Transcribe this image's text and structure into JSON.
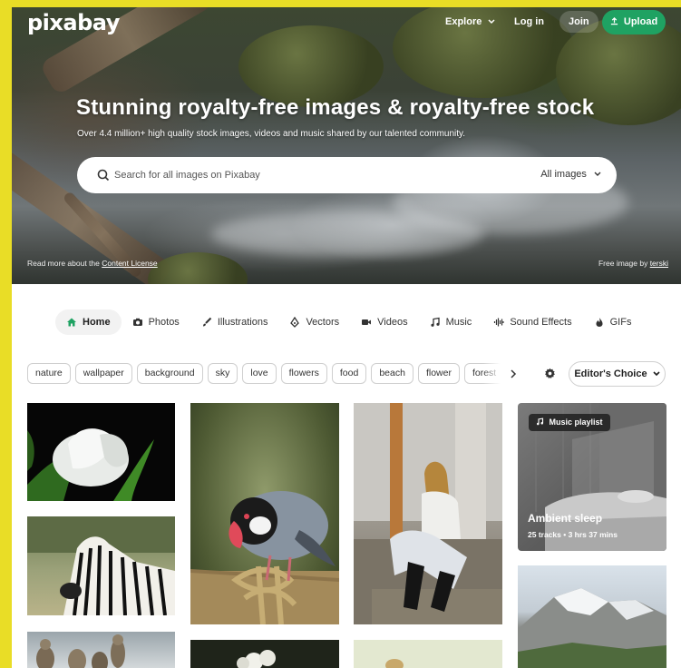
{
  "header": {
    "logo": "pixabay",
    "nav": {
      "explore": "Explore",
      "login": "Log in",
      "join": "Join",
      "upload": "Upload"
    }
  },
  "hero": {
    "title": "Stunning royalty-free images & royalty-free stock",
    "subtitle": "Over 4.4 million+ high quality stock images, videos and music shared by our talented community.",
    "search_placeholder": "Search for all images on Pixabay",
    "search_filter": "All images",
    "license_prefix": "Read more about the ",
    "license_link": "Content License",
    "credit_prefix": "Free image by ",
    "credit_author": "terski"
  },
  "categories": [
    {
      "label": "Home",
      "icon": "home-icon",
      "active": true
    },
    {
      "label": "Photos",
      "icon": "camera-icon"
    },
    {
      "label": "Illustrations",
      "icon": "brush-icon"
    },
    {
      "label": "Vectors",
      "icon": "pen-nib-icon"
    },
    {
      "label": "Videos",
      "icon": "video-camera-icon"
    },
    {
      "label": "Music",
      "icon": "music-note-icon"
    },
    {
      "label": "Sound Effects",
      "icon": "sound-wave-icon"
    },
    {
      "label": "GIFs",
      "icon": "flame-icon"
    }
  ],
  "tags": [
    "nature",
    "wallpaper",
    "background",
    "sky",
    "love",
    "flowers",
    "food",
    "beach",
    "flower",
    "forest"
  ],
  "sort": {
    "label": "Editor's Choice"
  },
  "playlist": {
    "badge": "Music playlist",
    "title": "Ambient sleep",
    "tracks": "25 tracks",
    "duration": "3 hrs 37 mins"
  },
  "colors": {
    "accent_green": "#1fa262",
    "frame_yellow": "#e9dd26"
  }
}
